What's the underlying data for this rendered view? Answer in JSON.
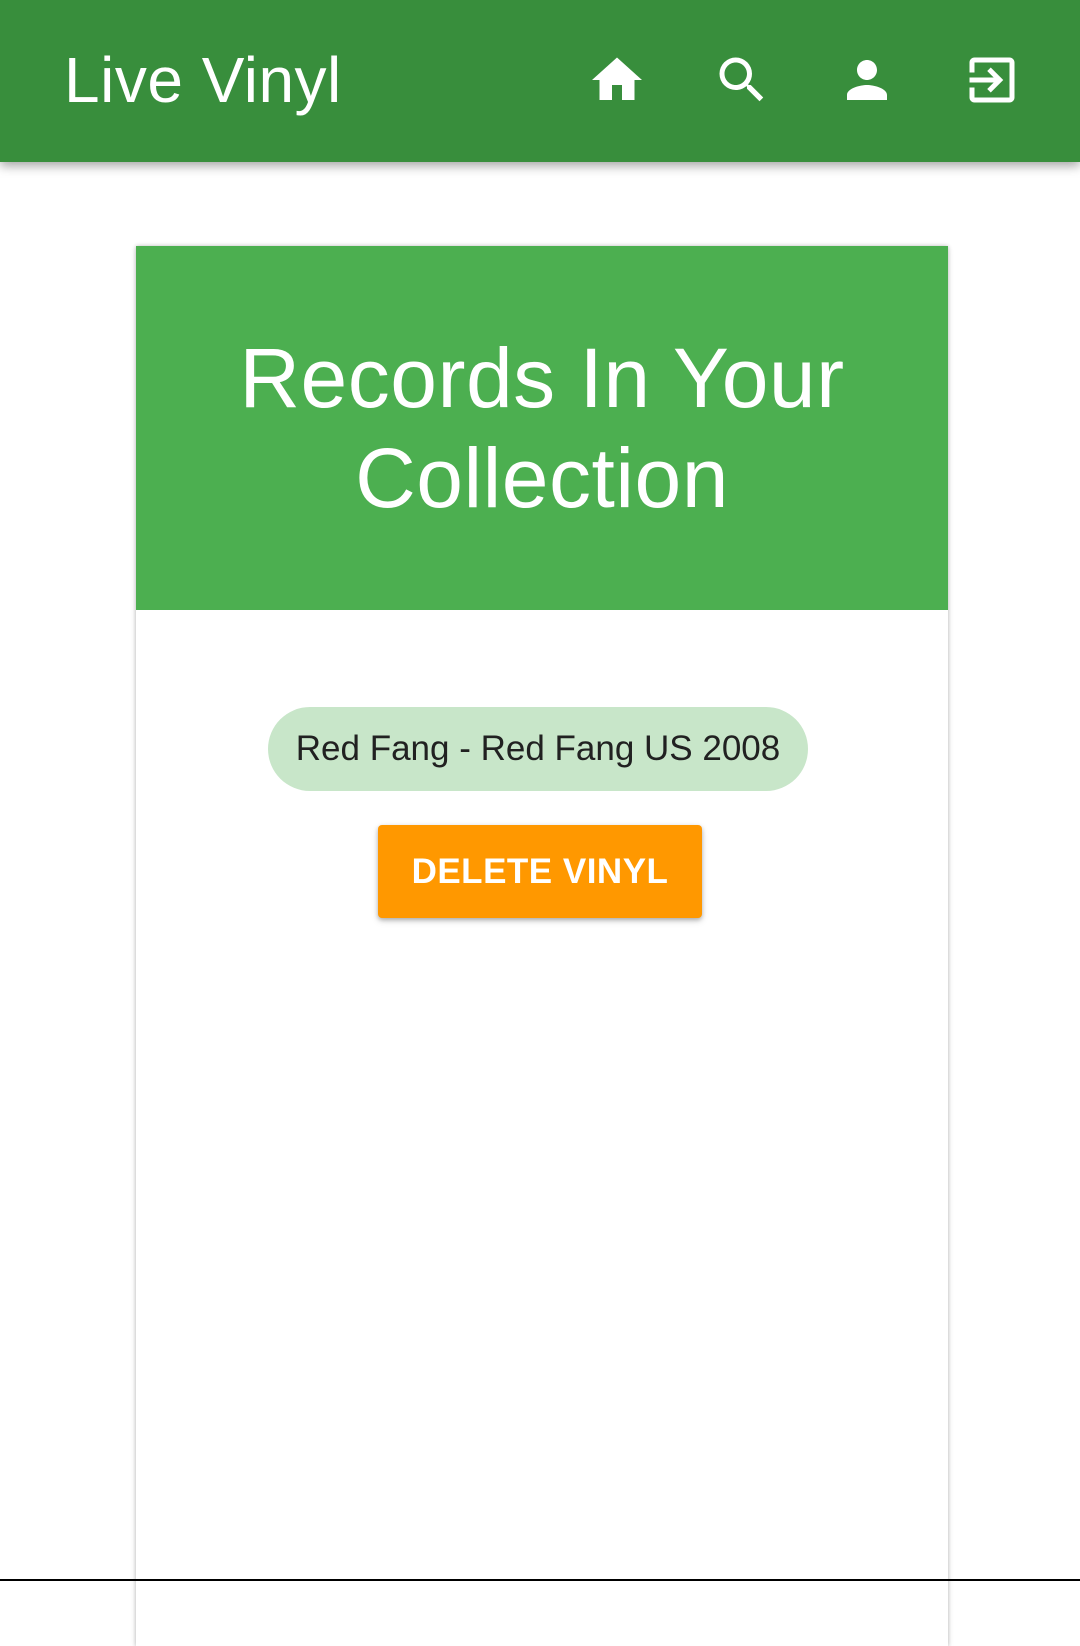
{
  "app_bar": {
    "title": "Live Vinyl",
    "nav_icons": [
      "home-icon",
      "search-icon",
      "account-icon",
      "login-icon"
    ],
    "background_color": "#388e3c"
  },
  "collection_card": {
    "title": "Records In Your Collection",
    "header_color": "#4caf50",
    "records": [
      {
        "label": "Red Fang - Red Fang US 2008",
        "chip_color": "#c8e6c9"
      }
    ],
    "delete_button_label": "DELETE VINYL",
    "delete_button_color": "#ff9800"
  }
}
